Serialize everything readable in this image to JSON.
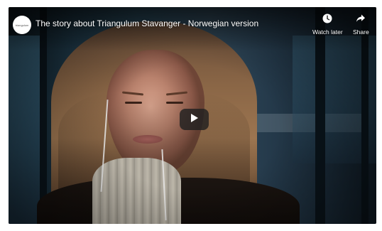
{
  "video": {
    "title": "The story about Triangulum Stavanger - Norwegian version",
    "channel_avatar_text": "triangulum"
  },
  "actions": {
    "watch_later_label": "Watch later",
    "watch_later_icon": "clock-icon",
    "share_label": "Share",
    "share_icon": "share-arrow-icon"
  },
  "player": {
    "play_icon": "play-icon",
    "colors": {
      "overlay_text": "#ffffff",
      "play_button_bg": "#212121"
    }
  }
}
